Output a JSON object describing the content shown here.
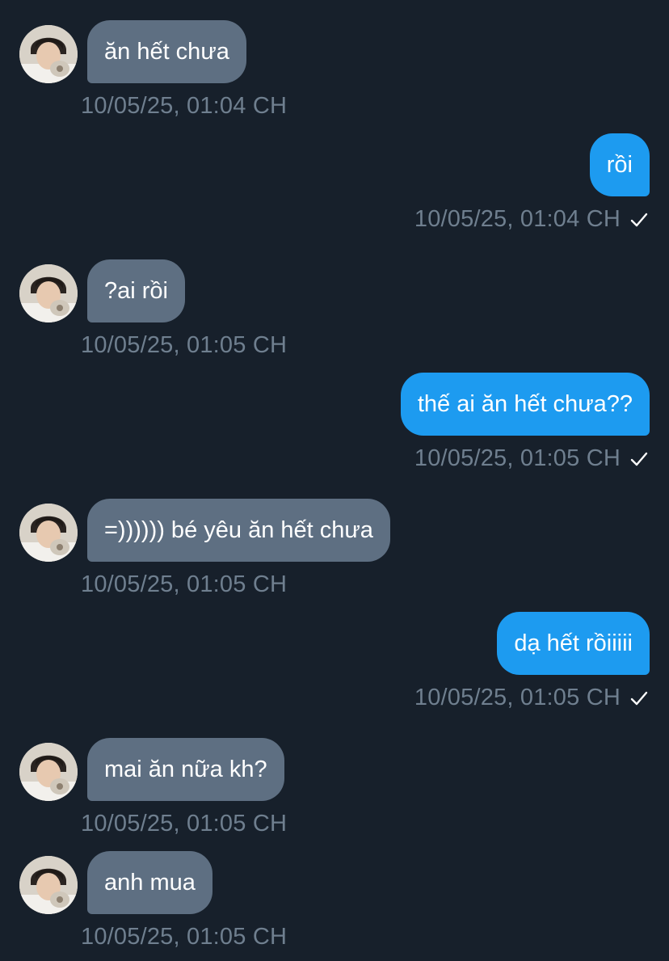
{
  "colors": {
    "background": "#17202b",
    "incoming_bubble": "#5e6f82",
    "outgoing_bubble": "#1d9bf0",
    "timestamp": "#6f7f8f"
  },
  "messages": [
    {
      "direction": "in",
      "text": "ăn hết chưa",
      "time": "10/05/25, 01:04 CH"
    },
    {
      "direction": "out",
      "text": "rồi",
      "time": "10/05/25, 01:04 CH",
      "read": true
    },
    {
      "direction": "in",
      "text": "?ai rồi",
      "time": "10/05/25, 01:05 CH"
    },
    {
      "direction": "out",
      "text": "thế ai ăn hết chưa??",
      "time": "10/05/25, 01:05 CH",
      "read": true
    },
    {
      "direction": "in",
      "text": "=)))))) bé yêu ăn hết chưa",
      "time": "10/05/25, 01:05 CH"
    },
    {
      "direction": "out",
      "text": "dạ hết rồiiiii",
      "time": "10/05/25, 01:05 CH",
      "read": true
    },
    {
      "direction": "in",
      "text": "mai ăn nữa kh?",
      "time": "10/05/25, 01:05 CH"
    },
    {
      "direction": "in",
      "text": "anh mua",
      "time": "10/05/25, 01:05 CH"
    }
  ]
}
